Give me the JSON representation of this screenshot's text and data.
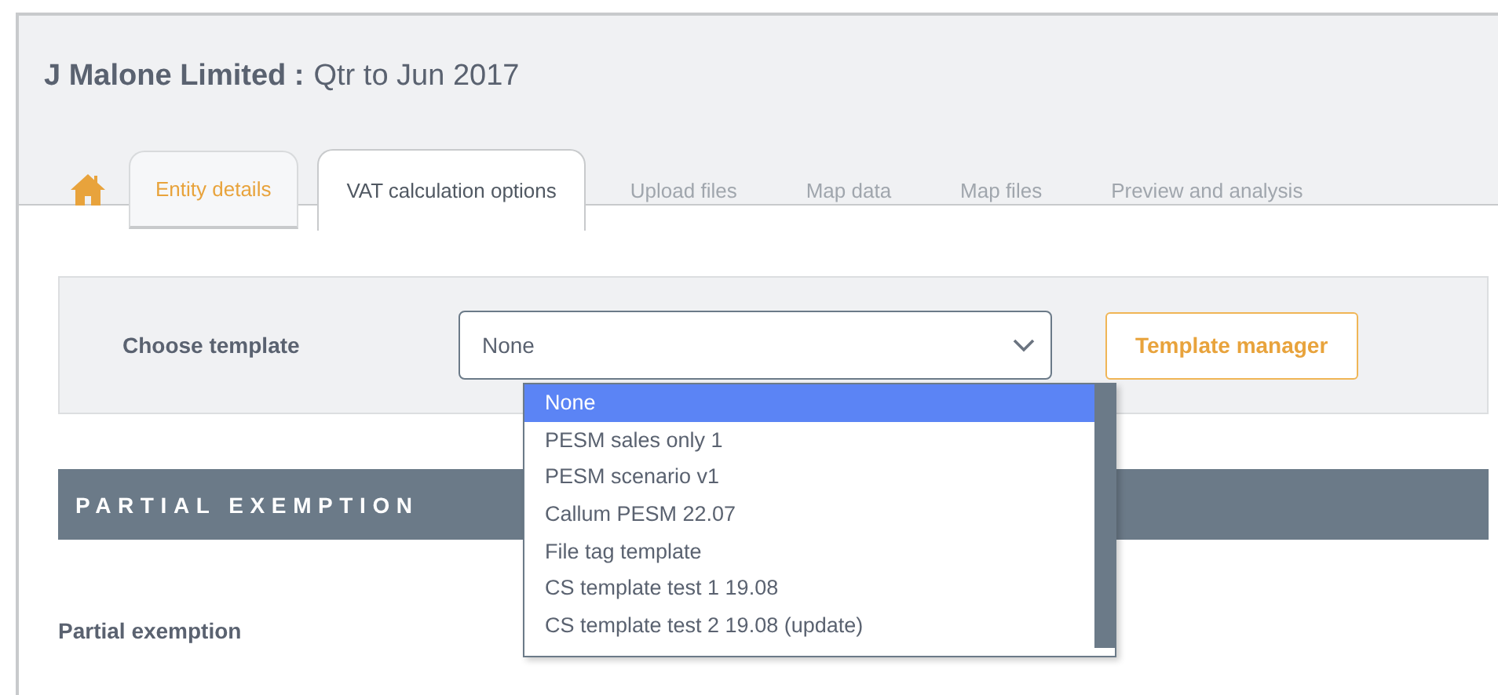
{
  "header": {
    "entity": "J Malone Limited :",
    "period": "Qtr to Jun 2017"
  },
  "tabs": [
    {
      "label": "Entity details",
      "selected": false,
      "completed": true
    },
    {
      "label": "VAT calculation options",
      "selected": true,
      "completed": false
    },
    {
      "label": "Upload files",
      "selected": false,
      "completed": false
    },
    {
      "label": "Map data",
      "selected": false,
      "completed": false
    },
    {
      "label": "Map files",
      "selected": false,
      "completed": false
    },
    {
      "label": "Preview and analysis",
      "selected": false,
      "completed": false
    }
  ],
  "template": {
    "label": "Choose template",
    "value": "None",
    "button": "Template manager",
    "expanded": true,
    "options": [
      {
        "label": "None",
        "selected": true
      },
      {
        "label": "PESM sales only 1",
        "selected": false
      },
      {
        "label": "PESM scenario v1",
        "selected": false
      },
      {
        "label": "Callum PESM 22.07",
        "selected": false
      },
      {
        "label": "File tag template",
        "selected": false
      },
      {
        "label": "CS template test 1 19.08",
        "selected": false
      },
      {
        "label": "CS template test 2 19.08 (update)",
        "selected": false
      }
    ]
  },
  "section": {
    "title": "PARTIAL EXEMPTION",
    "field_label": "Partial exemption"
  }
}
